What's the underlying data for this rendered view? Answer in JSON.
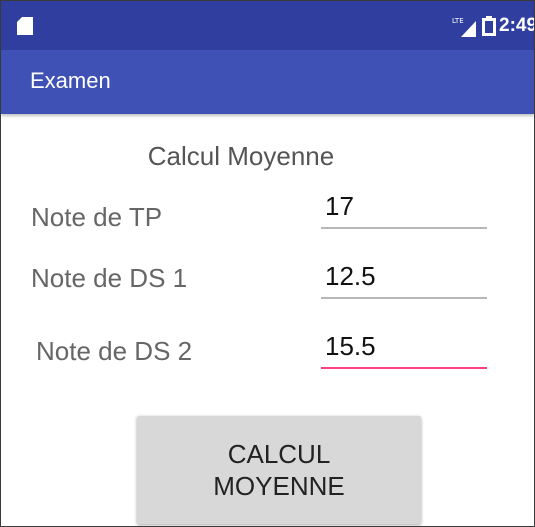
{
  "status_bar": {
    "time": "2:49",
    "network_label": "LTE",
    "icons": [
      "sim-card-icon",
      "lte-signal-icon",
      "battery-icon"
    ]
  },
  "app_bar": {
    "title": "Examen"
  },
  "form": {
    "heading": "Calcul Moyenne",
    "fields": [
      {
        "label": "Note de TP",
        "value": "17"
      },
      {
        "label": "Note de DS 1",
        "value": "12.5"
      },
      {
        "label": "Note de DS 2",
        "value": "15.5"
      }
    ],
    "button_label": "CALCUL MOYENNE"
  },
  "colors": {
    "status_bar": "#303f9f",
    "app_bar": "#3f51b5",
    "focus_accent": "#ff4081",
    "button_background": "#d8d8d8"
  }
}
